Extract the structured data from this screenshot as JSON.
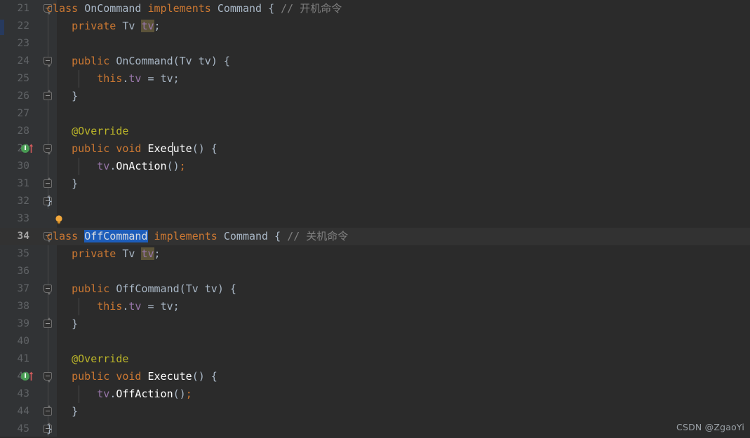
{
  "editor": {
    "theme": "darcula",
    "background": "#2b2b2b",
    "gutter_background": "#313335",
    "current_line": 34,
    "selection_color": "#1d5dba",
    "first_line": 21,
    "last_line": 45
  },
  "watermark": {
    "text": "CSDN @ZgaoYi"
  },
  "lines": [
    {
      "no": "21",
      "text": "class OnCommand implements Command { // 开机命令"
    },
    {
      "no": "22",
      "text": "    private Tv tv;"
    },
    {
      "no": "23",
      "text": ""
    },
    {
      "no": "24",
      "text": "    public OnCommand(Tv tv) {"
    },
    {
      "no": "25",
      "text": "        this.tv = tv;"
    },
    {
      "no": "26",
      "text": "    }"
    },
    {
      "no": "27",
      "text": ""
    },
    {
      "no": "28",
      "text": "    @Override"
    },
    {
      "no": "29",
      "text": "    public void Execute() {"
    },
    {
      "no": "30",
      "text": "        tv.OnAction();"
    },
    {
      "no": "31",
      "text": "    }"
    },
    {
      "no": "32",
      "text": "}"
    },
    {
      "no": "33",
      "text": ""
    },
    {
      "no": "34",
      "text": "class OffCommand implements Command { // 关机命令"
    },
    {
      "no": "35",
      "text": "    private Tv tv;"
    },
    {
      "no": "36",
      "text": ""
    },
    {
      "no": "37",
      "text": "    public OffCommand(Tv tv) {"
    },
    {
      "no": "38",
      "text": "        this.tv = tv;"
    },
    {
      "no": "39",
      "text": "    }"
    },
    {
      "no": "40",
      "text": ""
    },
    {
      "no": "41",
      "text": "    @Override"
    },
    {
      "no": "42",
      "text": "    public void Execute() {"
    },
    {
      "no": "43",
      "text": "        tv.OffAction();"
    },
    {
      "no": "44",
      "text": "    }"
    },
    {
      "no": "45",
      "text": "}"
    }
  ],
  "tokens": {
    "kw_class": "class",
    "kw_private": "private",
    "kw_public": "public",
    "kw_void": "void",
    "kw_implements": "implements",
    "kw_this": "this",
    "type_tv": "Tv",
    "type_command": "Command",
    "cls_oncommand": "OnCommand",
    "cls_offcommand": "OffCommand",
    "field_tv": "tv",
    "annotation_override": "@Override",
    "method_execute": "Execute",
    "method_onaction": "OnAction",
    "method_offaction": "OffAction",
    "comment_on": "// 开机命令",
    "comment_off": "// 关机命令",
    "brace_open": "{",
    "brace_close": "}",
    "paren_open": "(",
    "paren_close": ")",
    "semicolon": ";",
    "dot": ".",
    "equals": "=",
    "space": " "
  },
  "gutter_icons": {
    "implements_marker": {
      "lines": [
        29,
        42
      ],
      "label": "I",
      "color": "#499c54",
      "arrow_color": "#d05b5b",
      "name": "implementing-method-icon"
    },
    "intention_bulb": {
      "line": 33,
      "color": "#f2a73b",
      "name": "intention-bulb-icon"
    },
    "fold_open": {
      "lines": [
        21,
        24,
        29,
        34,
        37,
        42
      ],
      "name": "fold-collapse-icon"
    },
    "fold_close": {
      "lines": [
        26,
        31,
        32,
        39,
        44,
        45
      ],
      "name": "fold-end-icon"
    }
  },
  "selection": {
    "line": 34,
    "text": "OffCommand"
  },
  "change_marker": {
    "line": 22,
    "color": "#273a5e"
  }
}
